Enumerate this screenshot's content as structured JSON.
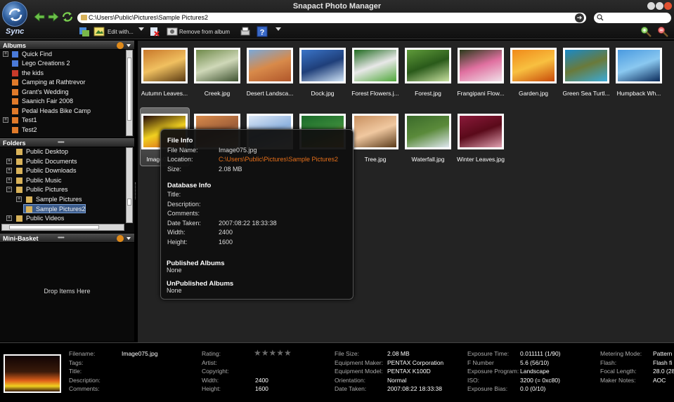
{
  "app": {
    "title": "Snapact Photo Manager",
    "sync_label": "Sync",
    "address": "C:\\Users\\Public\\Pictures\\Sample Pictures2",
    "search_placeholder": ""
  },
  "toolbar": {
    "edit_with": "Edit with...",
    "remove_from_album": "Remove from album"
  },
  "albums": {
    "title": "Albums",
    "items": [
      {
        "label": "Quick Find"
      },
      {
        "label": "Lego Creations 2"
      },
      {
        "label": "the kids"
      },
      {
        "label": "Camping at Rathtrevor"
      },
      {
        "label": "Grant's Wedding"
      },
      {
        "label": "Saanich Fair 2008"
      },
      {
        "label": "Pedal Heads Bike Camp"
      },
      {
        "label": "Test1"
      },
      {
        "label": "Test2"
      }
    ]
  },
  "folders": {
    "title": "Folders",
    "items": [
      {
        "label": "Public Desktop"
      },
      {
        "label": "Public Documents"
      },
      {
        "label": "Public Downloads"
      },
      {
        "label": "Public Music"
      },
      {
        "label": "Public Pictures"
      },
      {
        "label": "Sample Pictures"
      },
      {
        "label": "Sample Pictures2"
      },
      {
        "label": "Public Videos"
      }
    ]
  },
  "mini_basket": {
    "title": "Mini-Basket",
    "empty_text": "Drop Items Here"
  },
  "thumbnails": [
    {
      "caption": "Autumn Leaves...",
      "colors": [
        "#c9782a",
        "#5a3a12",
        "#f0c060"
      ]
    },
    {
      "caption": "Creek.jpg",
      "colors": [
        "#6f8a4a",
        "#3e5230",
        "#cfd8b8"
      ]
    },
    {
      "caption": "Desert Landsca...",
      "colors": [
        "#7aa8d8",
        "#b0562a",
        "#d88a4a"
      ]
    },
    {
      "caption": "Dock.jpg",
      "colors": [
        "#3a74c8",
        "#cfe3f6",
        "#1f3f7a"
      ]
    },
    {
      "caption": "Forest Flowers.j...",
      "colors": [
        "#1f6a1f",
        "#4fa83a",
        "#e8e8e8"
      ]
    },
    {
      "caption": "Forest.jpg",
      "colors": [
        "#5f9a3a",
        "#c8e0a0",
        "#2a5a1a"
      ]
    },
    {
      "caption": "Frangipani Flow...",
      "colors": [
        "#2a3a1a",
        "#f0e0e8",
        "#e070a0"
      ]
    },
    {
      "caption": "Garden.jpg",
      "colors": [
        "#f08a1a",
        "#c84a0a",
        "#f8c040"
      ]
    },
    {
      "caption": "Green Sea Turtl...",
      "colors": [
        "#1a8ac8",
        "#3aaad8",
        "#6a7a3a"
      ]
    },
    {
      "caption": "Humpback Wh...",
      "colors": [
        "#4a9ae0",
        "#0a2a5a",
        "#8ac8f0"
      ]
    },
    {
      "caption": "Image075.jpg",
      "colors": [
        "#200808",
        "#d8501a",
        "#f0d020"
      ]
    },
    {
      "caption": "",
      "colors": [
        "#d88a4a",
        "#f0c090",
        "#a0603a"
      ]
    },
    {
      "caption": "",
      "colors": [
        "#dde8f5",
        "#ffffff",
        "#8fb3e0"
      ]
    },
    {
      "caption": "",
      "colors": [
        "#1a6a2a",
        "#f0a020",
        "#3a8a3a"
      ]
    },
    {
      "caption": "Tree.jpg",
      "colors": [
        "#c89060",
        "#5a3a1a",
        "#f0c8a0"
      ]
    },
    {
      "caption": "Waterfall.jpg",
      "colors": [
        "#3a6a2a",
        "#e0e8f0",
        "#5a8a3a"
      ]
    },
    {
      "caption": "Winter Leaves.jpg",
      "colors": [
        "#8a1a3a",
        "#e0a0b0",
        "#5a0a1a"
      ]
    }
  ],
  "tooltip": {
    "file_info_title": "File Info",
    "file_name_label": "File Name:",
    "file_name": "Image075.jpg",
    "location_label": "Location:",
    "location": "C:\\Users\\Public\\Pictures\\Sample Pictures2",
    "size_label": "Size:",
    "size": "2.08 MB",
    "db_title": "Database Info",
    "title_label": "Title:",
    "description_label": "Description:",
    "comments_label": "Comments:",
    "date_taken_label": "Date Taken:",
    "date_taken": "2007:08:22 18:33:38",
    "width_label": "Width:",
    "width": "2400",
    "height_label": "Height:",
    "height": "1600",
    "published_title": "Published Albums",
    "published_value": "None",
    "unpublished_title": "UnPublished Albums",
    "unpublished_value": "None",
    "location_color": "#e8701a"
  },
  "details": {
    "filename_label": "Filename:",
    "filename": "Image075.jpg",
    "tags_label": "Tags:",
    "title_label": "Title:",
    "description_label": "Description:",
    "comments_label": "Comments:",
    "rating_label": "Rating:",
    "artist_label": "Artist:",
    "copyright_label": "Copyright:",
    "width_label": "Width:",
    "width": "2400",
    "height_label": "Height:",
    "height": "1600",
    "file_size_label": "File Size:",
    "file_size": "2.08 MB",
    "equipment_maker_label": "Equipment Maker:",
    "equipment_maker": "PENTAX Corporation",
    "equipment_model_label": "Equipment Model:",
    "equipment_model": "PENTAX K100D",
    "orientation_label": "Orientation:",
    "orientation": "Normal",
    "date_taken_label": "Date Taken:",
    "date_taken": "2007:08:22 18:33:38",
    "exposure_time_label": "Exposure Time:",
    "exposure_time": "0.011111 (1/90)",
    "f_number_label": "F Number",
    "f_number": "5.6 (56/10)",
    "exposure_program_label": "Exposure Program:",
    "exposure_program": "Landscape",
    "iso_label": "ISO:",
    "iso": "3200 (= 0xc80)",
    "exposure_bias_label": "Exposure Bias:",
    "exposure_bias": "0.0 (0/10)",
    "metering_mode_label": "Metering Mode:",
    "metering_mode": "Pattern",
    "flash_label": "Flash:",
    "flash": "Flash fi",
    "focal_length_label": "Focal Length:",
    "focal_length": "28.0 (28",
    "maker_notes_label": "Maker Notes:",
    "maker_notes": "AOC"
  }
}
